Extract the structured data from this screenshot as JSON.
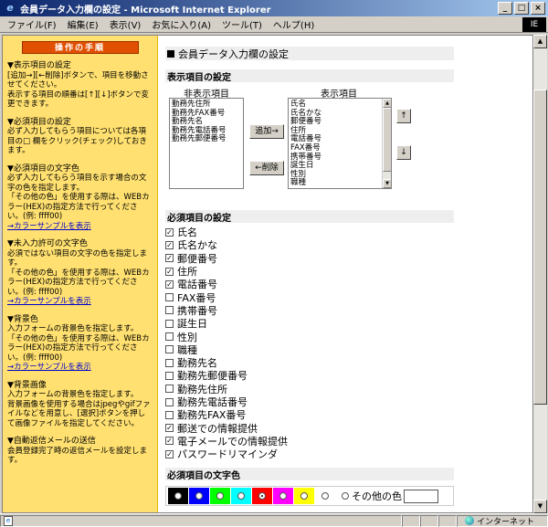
{
  "window": {
    "title": "会員データ入力欄の設定 - Microsoft Internet Explorer",
    "btn_min": "_",
    "btn_max": "□",
    "btn_close": "×",
    "logo": "IE"
  },
  "menu": [
    "ファイル(F)",
    "編集(E)",
    "表示(V)",
    "お気に入り(A)",
    "ツール(T)",
    "ヘルプ(H)"
  ],
  "sidebar": {
    "header": "操作の手順",
    "sections": [
      {
        "title": "▼表示項目の設定",
        "lines": [
          "[追加→][←削除]ボタンで、項目を移動させてください。",
          "表示する項目の順番は[↑][↓]ボタンで変更できます。"
        ]
      },
      {
        "title": "▼必須項目の設定",
        "lines": [
          "必ず入力してもらう項目については各項目の□ 欄をクリック(チェック)しておきます。"
        ]
      },
      {
        "title": "▼必須項目の文字色",
        "lines": [
          "必ず入力してもらう項目を示す場合の文字の色を指定します。",
          "「その他の色」を使用する際は、WEBカラー(HEX)の指定方法で行ってください。(例: ffff00)"
        ],
        "link": "→カラーサンプルを表示"
      },
      {
        "title": "▼未入力許可の文字色",
        "lines": [
          "必須ではない項目の文字の色を指定します。",
          "「その他の色」を使用する際は、WEBカラー(HEX)の指定方法で行ってください。(例: ffff00)"
        ],
        "link": "→カラーサンプルを表示"
      },
      {
        "title": "▼背景色",
        "lines": [
          "入力フォームの背景色を指定します。",
          "「その他の色」を使用する際は、WEBカラー(HEX)の指定方法で行ってください。(例: ffff00)"
        ],
        "link": "→カラーサンプルを表示"
      },
      {
        "title": "▼背景画像",
        "lines": [
          "入力フォームの背景色を指定します。",
          "背景画像を使用する場合はjpegやgifファイルなどを用意し、[選択]ボタンを押して画像ファイルを指定してください。"
        ]
      },
      {
        "title": "▼自動返信メールの送信",
        "lines": [
          "会員登録完了時の返信メールを設定します。"
        ]
      }
    ]
  },
  "main": {
    "page_title": "会員データ入力欄の設定",
    "display_section": "表示項目の設定",
    "hidden_label": "非表示項目",
    "shown_label": "表示項目",
    "hidden_items": [
      "勤務先住所",
      "勤務先FAX番号",
      "勤務先名",
      "勤務先電話番号",
      "勤務先郵便番号"
    ],
    "shown_items": [
      "氏名",
      "氏名かな",
      "郵便番号",
      "住所",
      "電話番号",
      "FAX番号",
      "携帯番号",
      "誕生日",
      "性別",
      "職種"
    ],
    "add_button": "追加→",
    "remove_button": "←削除",
    "up_button": "↑",
    "down_button": "↓",
    "required_section": "必須項目の設定",
    "required_items": [
      {
        "label": "氏名",
        "checked": true
      },
      {
        "label": "氏名かな",
        "checked": true
      },
      {
        "label": "郵便番号",
        "checked": true
      },
      {
        "label": "住所",
        "checked": true
      },
      {
        "label": "電話番号",
        "checked": true
      },
      {
        "label": "FAX番号",
        "checked": false
      },
      {
        "label": "携帯番号",
        "checked": false
      },
      {
        "label": "誕生日",
        "checked": false
      },
      {
        "label": "性別",
        "checked": false
      },
      {
        "label": "職種",
        "checked": false
      },
      {
        "label": "勤務先名",
        "checked": false
      },
      {
        "label": "勤務先郵便番号",
        "checked": false
      },
      {
        "label": "勤務先住所",
        "checked": false
      },
      {
        "label": "勤務先電話番号",
        "checked": false
      },
      {
        "label": "勤務先FAX番号",
        "checked": false
      },
      {
        "label": "郵送での情報提供",
        "checked": true
      },
      {
        "label": "電子メールでの情報提供",
        "checked": true
      },
      {
        "label": "パスワードリマインダ",
        "checked": true
      }
    ],
    "color_section": "必須項目の文字色",
    "colors": [
      {
        "hex": "#000000",
        "selected": false
      },
      {
        "hex": "#0000ff",
        "selected": false
      },
      {
        "hex": "#00ff00",
        "selected": false
      },
      {
        "hex": "#00ffff",
        "selected": false
      },
      {
        "hex": "#ff0000",
        "selected": true
      },
      {
        "hex": "#ff00ff",
        "selected": false
      },
      {
        "hex": "#ffff00",
        "selected": false
      },
      {
        "hex": "#ffffff",
        "selected": false
      }
    ],
    "other_color_label": "その他の色"
  },
  "status": {
    "zone": "インターネット"
  }
}
